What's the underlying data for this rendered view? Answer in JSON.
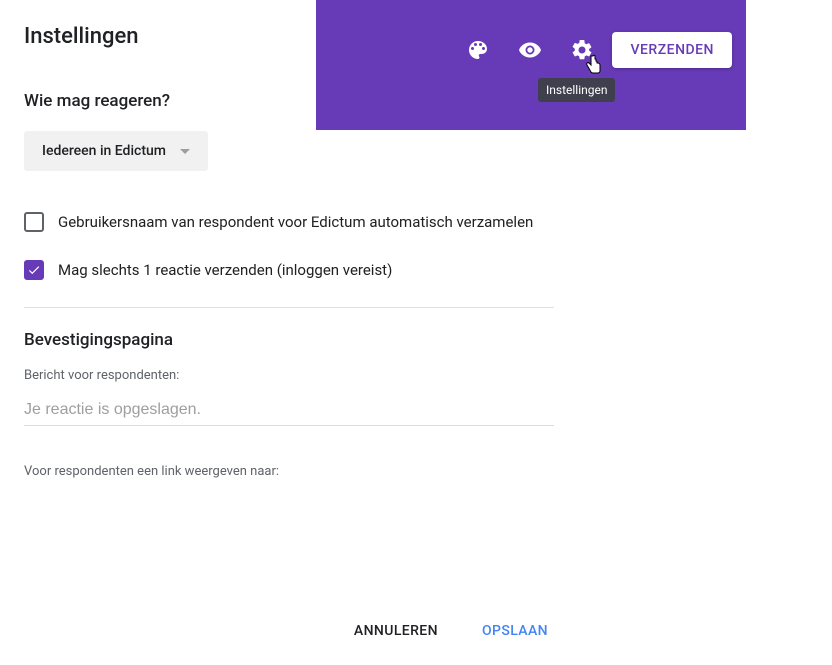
{
  "toolbar": {
    "send_label": "VERZENDEN",
    "tooltip": "Instellingen"
  },
  "panel": {
    "title": "Instellingen",
    "who_can_respond_heading": "Wie mag reageren?",
    "dropdown_value": "Iedereen in Edictum",
    "checkbox_collect": "Gebruikersnaam van respondent voor Edictum automatisch verzamelen",
    "checkbox_once": "Mag slechts 1 reactie verzenden (inloggen vereist)",
    "confirmation_heading": "Bevestigingspagina",
    "message_label": "Bericht voor respondenten:",
    "message_value": "Je reactie is opgeslagen.",
    "link_label": "Voor respondenten een link weergeven naar:"
  },
  "footer": {
    "cancel": "ANNULEREN",
    "save": "OPSLAAN"
  },
  "colors": {
    "accent": "#673ab7",
    "save_blue": "#4285f4"
  }
}
